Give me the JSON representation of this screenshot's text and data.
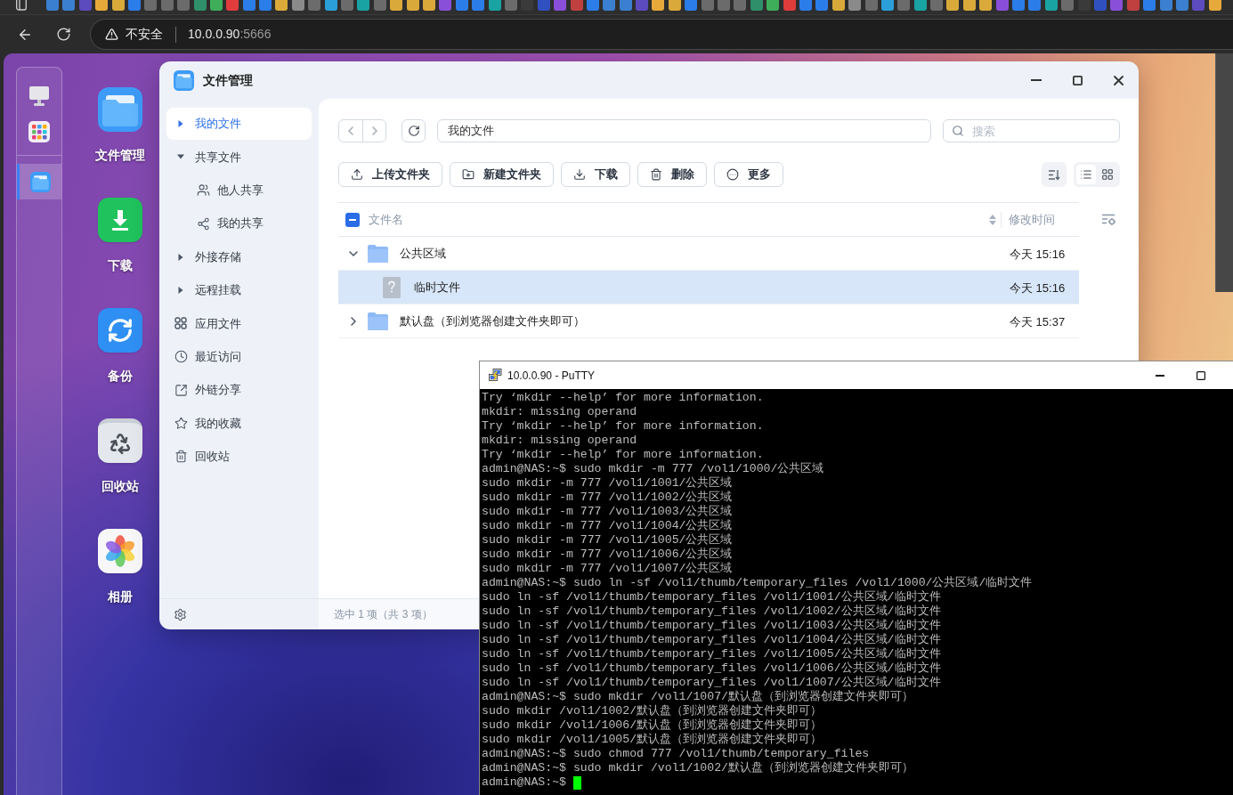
{
  "browser": {
    "security_label": "不安全",
    "url_host": "10.0.0.90",
    "url_port": ":5666"
  },
  "dock": {
    "pinned": [
      {
        "kind": "monitor"
      },
      {
        "kind": "apps"
      }
    ],
    "open_windows": [
      {
        "kind": "files",
        "selected": true
      }
    ]
  },
  "desktop": {
    "icons": [
      {
        "kind": "files",
        "label": "文件管理"
      },
      {
        "kind": "download",
        "label": "下载"
      },
      {
        "kind": "backup",
        "label": "备份"
      },
      {
        "kind": "recycle",
        "label": "回收站"
      },
      {
        "kind": "photos",
        "label": "相册"
      }
    ]
  },
  "file_manager": {
    "title": "文件管理",
    "sidebar": {
      "items": [
        {
          "kind": "tree",
          "label": "我的文件",
          "expanded": false,
          "selected": true
        },
        {
          "kind": "tree",
          "label": "共享文件",
          "expanded": true,
          "selected": false,
          "children": [
            {
              "kind": "shared_with_me",
              "label": "他人共享",
              "selected": false
            },
            {
              "kind": "my_shares",
              "label": "我的共享",
              "selected": false
            }
          ]
        },
        {
          "kind": "tree",
          "label": "外接存储",
          "expanded": false,
          "selected": false
        },
        {
          "kind": "tree",
          "label": "远程挂载",
          "expanded": false,
          "selected": false
        },
        {
          "kind": "apps",
          "label": "应用文件",
          "selected": false
        },
        {
          "kind": "recent",
          "label": "最近访问",
          "selected": false
        },
        {
          "kind": "links",
          "label": "外链分享",
          "selected": false
        },
        {
          "kind": "favorites",
          "label": "我的收藏",
          "selected": false
        },
        {
          "kind": "trash",
          "label": "回收站",
          "selected": false
        }
      ]
    },
    "path": "我的文件",
    "search": {
      "placeholder": "搜索"
    },
    "toolbar": [
      {
        "kind": "upload",
        "label": "上传文件夹"
      },
      {
        "kind": "new_folder",
        "label": "新建文件夹"
      },
      {
        "kind": "download",
        "label": "下载"
      },
      {
        "kind": "delete",
        "label": "删除"
      },
      {
        "kind": "more",
        "label": "更多"
      }
    ],
    "views": [
      {
        "kind": "list",
        "selected": true
      },
      {
        "kind": "grid",
        "selected": false
      }
    ],
    "table": {
      "select_all": {
        "indeterminate": true
      },
      "columns": [
        {
          "label": "文件名"
        },
        {
          "label": "修改时间"
        }
      ],
      "rows": [
        {
          "kind": "folder",
          "name": "公共区域",
          "modified": "今天 15:16",
          "expanded": true,
          "selected": false,
          "children": [
            {
              "kind": "unknown",
              "name": "临时文件",
              "modified": "今天 15:16",
              "selected": true
            }
          ]
        },
        {
          "kind": "folder",
          "name": "默认盘（到浏览器创建文件夹即可）",
          "modified": "今天 15:37",
          "expanded": false,
          "selected": false
        }
      ]
    },
    "status": "选中 1 项（共 3 项）"
  },
  "terminal": {
    "title": "10.0.0.90 - PuTTY",
    "lines": [
      "Try ‘mkdir --help’ for more information.",
      "mkdir: missing operand",
      "Try ‘mkdir --help’ for more information.",
      "mkdir: missing operand",
      "Try ‘mkdir --help’ for more information.",
      "admin@NAS:~$ sudo mkdir -m 777 /vol1/1000/公共区域",
      "sudo mkdir -m 777 /vol1/1001/公共区域",
      "sudo mkdir -m 777 /vol1/1002/公共区域",
      "sudo mkdir -m 777 /vol1/1003/公共区域",
      "sudo mkdir -m 777 /vol1/1004/公共区域",
      "sudo mkdir -m 777 /vol1/1005/公共区域",
      "sudo mkdir -m 777 /vol1/1006/公共区域",
      "sudo mkdir -m 777 /vol1/1007/公共区域",
      "admin@NAS:~$ sudo ln -sf /vol1/thumb/temporary_files /vol1/1000/公共区域/临时文件",
      "sudo ln -sf /vol1/thumb/temporary_files /vol1/1001/公共区域/临时文件",
      "sudo ln -sf /vol1/thumb/temporary_files /vol1/1002/公共区域/临时文件",
      "sudo ln -sf /vol1/thumb/temporary_files /vol1/1003/公共区域/临时文件",
      "sudo ln -sf /vol1/thumb/temporary_files /vol1/1004/公共区域/临时文件",
      "sudo ln -sf /vol1/thumb/temporary_files /vol1/1005/公共区域/临时文件",
      "sudo ln -sf /vol1/thumb/temporary_files /vol1/1006/公共区域/临时文件",
      "sudo ln -sf /vol1/thumb/temporary_files /vol1/1007/公共区域/临时文件",
      "admin@NAS:~$ sudo mkdir /vol1/1007/默认盘（到浏览器创建文件夹即可）",
      "sudo mkdir /vol1/1002/默认盘（到浏览器创建文件夹即可）",
      "sudo mkdir /vol1/1006/默认盘（到浏览器创建文件夹即可）",
      "sudo mkdir /vol1/1005/默认盘（到浏览器创建文件夹即可）",
      "admin@NAS:~$ sudo chmod 777 /vol1/thumb/temporary_files",
      "admin@NAS:~$ sudo mkdir /vol1/1002/默认盘（到浏览器创建文件夹即可）",
      "admin@NAS:~$"
    ],
    "cursor": true
  }
}
